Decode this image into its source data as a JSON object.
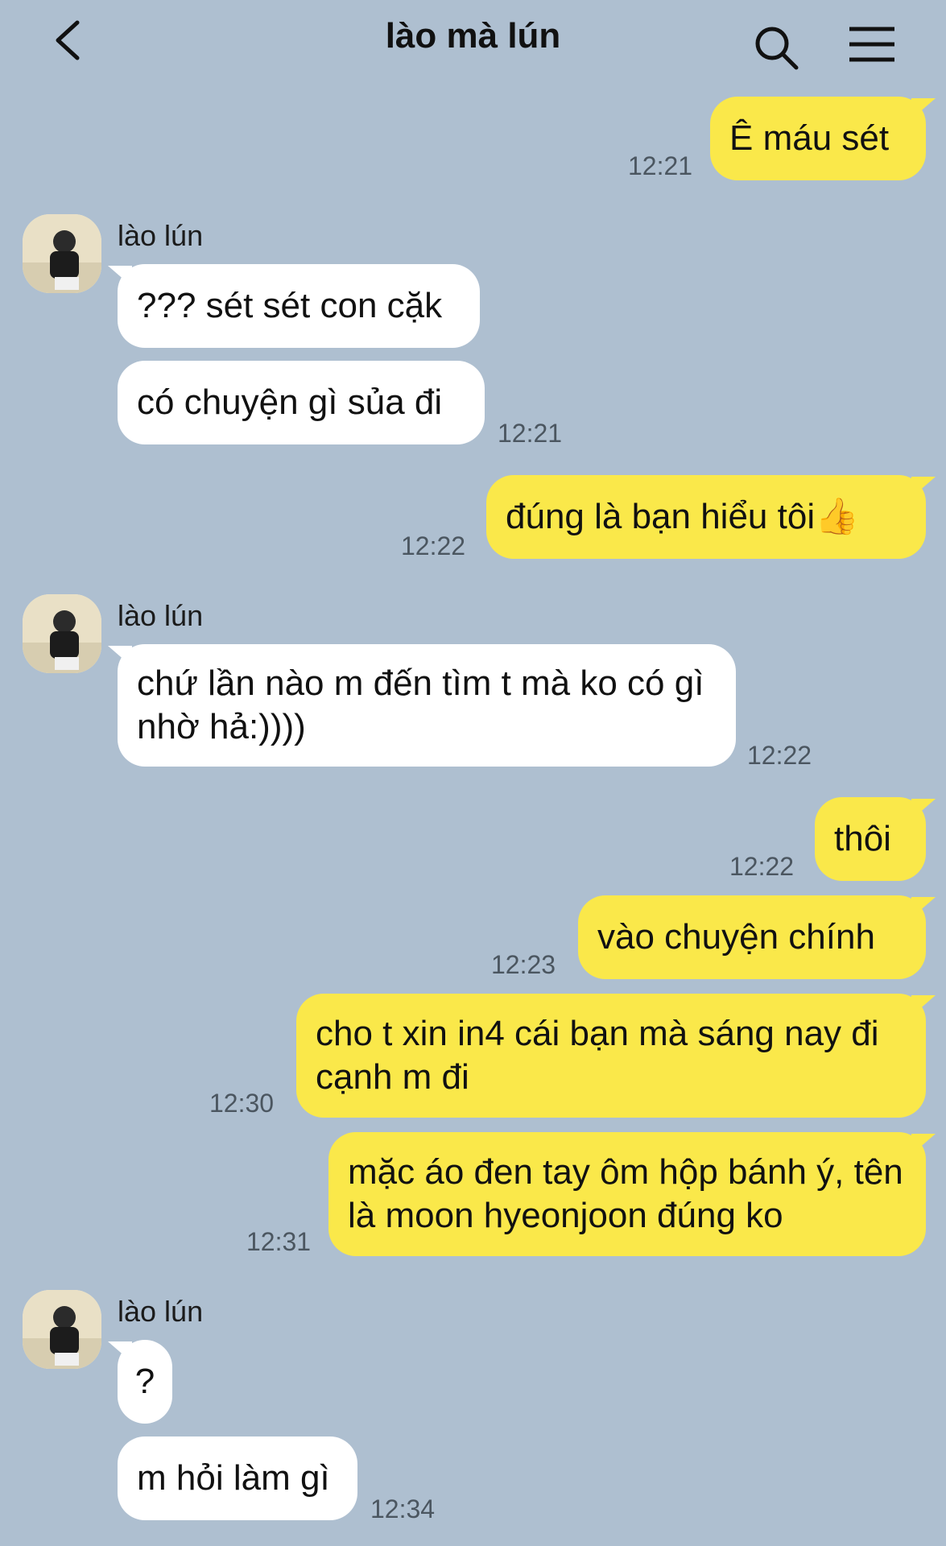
{
  "header": {
    "title": "lào mà lún",
    "back_icon": "chevron-left-icon",
    "search_icon": "search-icon",
    "menu_icon": "menu-icon"
  },
  "colors": {
    "background": "#aebfd0",
    "my_bubble": "#fae84a",
    "their_bubble": "#ffffff"
  },
  "messages": [
    {
      "text": "Ê máu sét",
      "time": "12:21"
    },
    {
      "sender": "lào lún",
      "text": "??? sét sét con cặk"
    },
    {
      "text": "có chuyện gì sủa đi",
      "time": "12:21"
    },
    {
      "text": "đúng là bạn hiểu tôi👍",
      "time": "12:22"
    },
    {
      "sender": "lào lún",
      "text": "chứ lần nào m đến tìm t mà ko có gì nhờ hả:))))",
      "time": "12:22"
    },
    {
      "text": "thôi",
      "time": "12:22"
    },
    {
      "text": "vào chuyện chính",
      "time": "12:23"
    },
    {
      "text": "cho t xin in4 cái bạn mà sáng nay đi cạnh m đi",
      "time": "12:30"
    },
    {
      "text": "mặc áo đen tay ôm hộp bánh ý, tên là moon hyeonjoon đúng ko",
      "time": "12:31"
    },
    {
      "sender": "lào lún",
      "text": "?"
    },
    {
      "text": "m hỏi làm gì",
      "time": "12:34"
    }
  ]
}
